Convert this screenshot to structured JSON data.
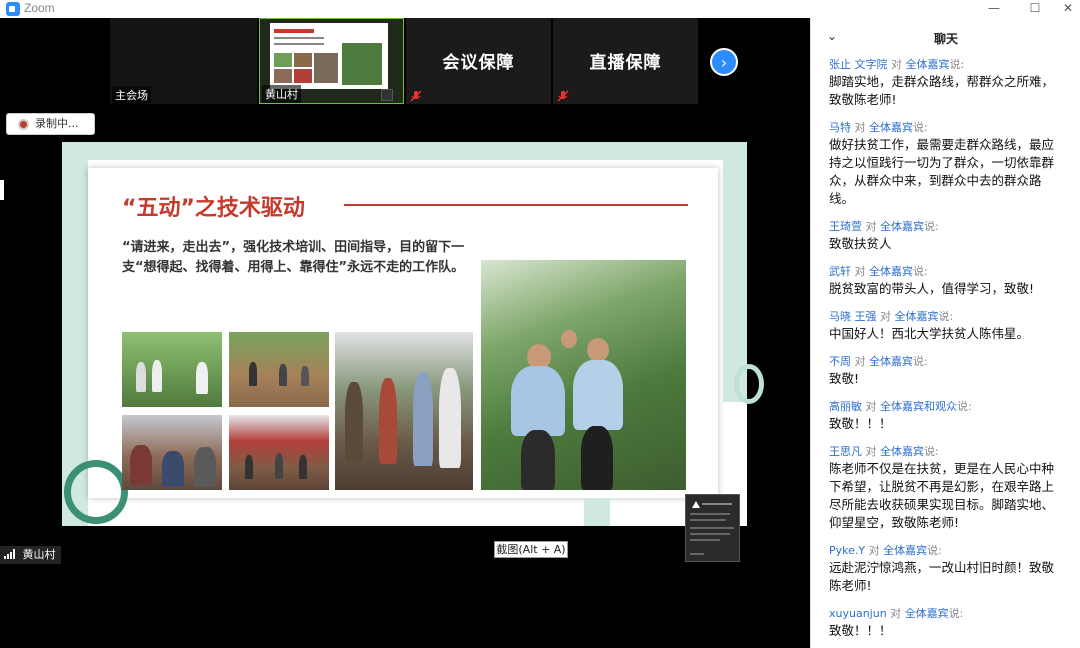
{
  "window": {
    "title": "Zoom",
    "buttons": {
      "minimize": "—",
      "maximize": "☐",
      "close": "✕"
    }
  },
  "video_strip": {
    "tiles": [
      {
        "name": "主会场",
        "label": ""
      },
      {
        "name": "黄山村",
        "label": ""
      },
      {
        "name": "",
        "label": "会议保障"
      },
      {
        "name": "",
        "label": "直播保障"
      }
    ],
    "next_icon": "chevron-right-icon",
    "muted_icon": "mic-muted-icon"
  },
  "recording": {
    "label": "录制中..."
  },
  "slide": {
    "title": "“五动”之技术驱动",
    "body": "“请进来，走出去”，强化技术培训、田间指导，目的留下一支“想得起、找得着、用得上、靠得住”永远不走的工作队。",
    "accent_color": "#c7392b",
    "frame_color": "#cfe8e0"
  },
  "screenshot_tip": "截图(Alt + A)",
  "self_view": {
    "name": "黄山村"
  },
  "chat": {
    "title": "聊天",
    "messages": [
      {
        "sender": "张止 文字院",
        "to": "全体嘉宾",
        "suffix": "说:",
        "text": "脚踏实地，走群众路线，帮群众之所难，致敬陈老师!"
      },
      {
        "sender": "马特",
        "to": "全体嘉宾",
        "suffix": "说:",
        "text": "做好扶贫工作，最需要走群众路线，最应持之以恒践行一切为了群众，一切依靠群众，从群众中来，到群众中去的群众路线。"
      },
      {
        "sender": "王琦萱",
        "to": "全体嘉宾",
        "suffix": "说:",
        "text": "致敬扶贫人"
      },
      {
        "sender": "武轩",
        "to": "全体嘉宾",
        "suffix": "说:",
        "text": "脱贫致富的带头人，值得学习，致敬!"
      },
      {
        "sender": "马晓 王强",
        "to": "全体嘉宾",
        "suffix": "说:",
        "text": "中国好人！西北大学扶贫人陈伟星。"
      },
      {
        "sender": "不周",
        "to": "全体嘉宾",
        "suffix": "说:",
        "text": "致敬!"
      },
      {
        "sender": "高丽敏",
        "to": "全体嘉宾和观众",
        "suffix": "说:",
        "text": "致敬！！！"
      },
      {
        "sender": "王思凡",
        "to": "全体嘉宾",
        "suffix": "说:",
        "text": "陈老师不仅是在扶贫，更是在人民心中种下希望，让脱贫不再是幻影，在艰辛路上尽所能去收获硕果实现目标。脚踏实地、仰望星空，致敬陈老师!"
      },
      {
        "sender": "Pyke.Y",
        "to": "全体嘉宾",
        "suffix": "说:",
        "text": "远赴泥泞惊鸿燕，一改山村旧时颜！致敬陈老师!"
      },
      {
        "sender": "xuyuanjun",
        "to": "全体嘉宾",
        "suffix": "说:",
        "text": "致敬！！！"
      }
    ]
  }
}
